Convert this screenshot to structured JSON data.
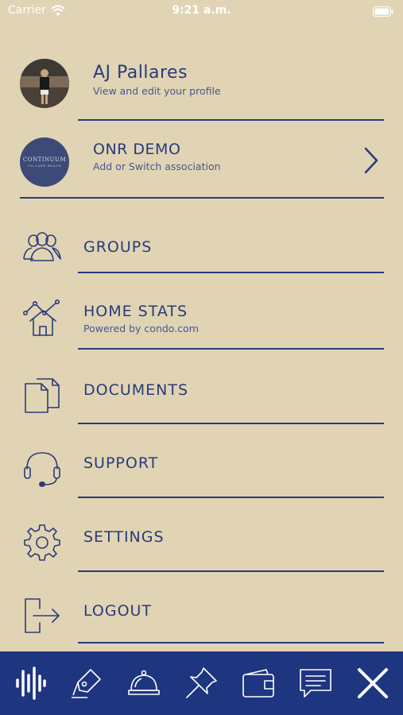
{
  "status_bar": {
    "carrier": "Carrier",
    "time": "9:21 a.m."
  },
  "profile": {
    "name": "AJ Pallares",
    "subtitle": "View and edit your profile"
  },
  "association": {
    "name": "ONR DEMO",
    "subtitle": "Add or Switch association",
    "logo_text_1": "CONTINUUM",
    "logo_text_2": "ON LAKE BEACH"
  },
  "menu": {
    "groups": {
      "label": "GROUPS"
    },
    "home_stats": {
      "label": "HOME STATS",
      "subtitle": "Powered by condo.com"
    },
    "documents": {
      "label": "DOCUMENTS"
    },
    "support": {
      "label": "SUPPORT"
    },
    "settings": {
      "label": "SETTINGS"
    },
    "logout": {
      "label": "LOGOUT"
    }
  },
  "tabbar": {
    "icons": [
      "audio-wave-icon",
      "pen-sign-icon",
      "service-bell-icon",
      "pin-icon",
      "wallet-icon",
      "chat-icon",
      "close-icon"
    ]
  },
  "colors": {
    "background": "#e0d4b4",
    "accent": "#2a3b7a",
    "tabbar": "#1e3580"
  }
}
